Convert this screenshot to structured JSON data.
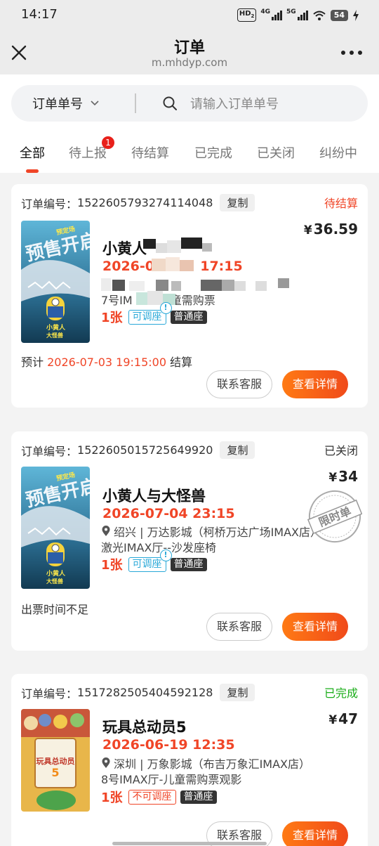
{
  "statusbar": {
    "time": "14:17",
    "hd": "HD",
    "hd_sub": "2",
    "net1": "4G",
    "net2": "5G",
    "battery": "54"
  },
  "nav": {
    "title": "订单",
    "url": "m.mhdyp.com",
    "back_icon": "close-icon",
    "more_icon": "more-icon"
  },
  "search": {
    "selector_label": "订单单号",
    "placeholder": "请输入订单单号"
  },
  "tabs": [
    {
      "label": "全部",
      "active": true
    },
    {
      "label": "待上报",
      "badge": "1"
    },
    {
      "label": "待结算"
    },
    {
      "label": "已完成"
    },
    {
      "label": "已关闭"
    },
    {
      "label": "纠纷中"
    }
  ],
  "copy_label": "复制",
  "btn_service": "联系客服",
  "btn_detail": "查看详情",
  "orders": [
    {
      "order_label": "订单编号：",
      "order_no": "1522605793274114048",
      "status": "待结算",
      "status_color": "#f04527",
      "price_cur": "¥",
      "price": "36.59",
      "title": "小黄人",
      "showtime": "2026-07",
      "showtime_tail": "17:15",
      "hall": "7号IM",
      "hall_tail": "童需购票",
      "qty": "1张",
      "adjust": "可调座",
      "info": "!",
      "seat": "普通座",
      "note_prefix": "预计 ",
      "note_time": "2026-07-03 19:15:00",
      "note_suffix": " 结算"
    },
    {
      "order_label": "订单编号：",
      "order_no": "1522605015725649920",
      "status": "已关闭",
      "status_color": "#333333",
      "price_cur": "¥",
      "price": "34",
      "title": "小黄人与大怪兽",
      "showtime": "2026-07-04 23:15",
      "location": "绍兴 | 万达影城（柯桥万达广场IMAX店）",
      "hall": "激光IMAX厅--沙发座椅",
      "qty": "1张",
      "adjust": "可调座",
      "info": "!",
      "seat": "普通座",
      "note": "出票时间不足",
      "stamp": "限时单"
    },
    {
      "order_label": "订单编号：",
      "order_no": "1517282505404592128",
      "status": "已完成",
      "status_color": "#1aad19",
      "price_cur": "¥",
      "price": "47",
      "title": "玩具总动员5",
      "showtime": "2026-06-19 12:35",
      "location": "深圳 | 万象影城（布吉万象汇IMAX店）",
      "hall": "8号IMAX厅-儿童需购票观影",
      "qty": "1张",
      "adjust": "不可调座",
      "seat": "普通座"
    }
  ],
  "poster1": {
    "top_text": "预定场",
    "big_text": "预售开启",
    "sub": "小黄人",
    "sub2": "大怪兽"
  },
  "poster3": {
    "title": "玩具总动员",
    "num": "5"
  }
}
